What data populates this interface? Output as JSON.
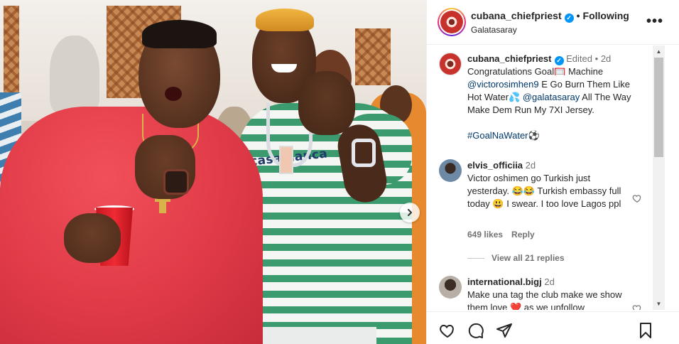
{
  "post": {
    "next_label": "›"
  },
  "header": {
    "username": "cubana_chiefpriest",
    "verified_mark": "✓",
    "separator": "•",
    "follow_label": "Following",
    "location": "Galatasaray",
    "more_label": "•••"
  },
  "photo": {
    "jersey_text": "casablanca"
  },
  "caption": {
    "username": "cubana_chiefpriest",
    "verified_mark": "✓",
    "edited": "Edited",
    "dot": "•",
    "time": "2d",
    "text_part1": "Congratulations Goal",
    "goal_emoji": "🥅",
    "text_part2": " Machine ",
    "mention1": "@victorosimhen9",
    "text_part3": " E Go Burn Them Like Hot Water",
    "water_emoji": "💦",
    "text_part4": " ",
    "mention2": "@galatasaray",
    "text_part5": " All The Way Make Dem Run My 7XI Jersey.",
    "hashtag": "#GoalNaWater",
    "ball_emoji": "⚽"
  },
  "comments": [
    {
      "username": "elvis_officiia",
      "time": "2d",
      "text": "Victor oshimen go Turkish just yesterday. 😂😂 Turkish embassy full today 😃 I swear. I too love Lagos ppl",
      "likes": "649 likes",
      "reply_label": "Reply",
      "view_replies": "View all 21 replies"
    },
    {
      "username": "international.bigj",
      "time": "2d",
      "text": "Make una tag the club make we show them love ❤️ as we unfollow"
    }
  ],
  "scrollbar": {
    "up": "▲",
    "down": "▼"
  },
  "colors": {
    "link": "#00376b",
    "verified": "#0095f6",
    "muted": "#737373"
  },
  "icons": [
    "heart-icon",
    "comment-icon",
    "share-icon",
    "save-icon",
    "more-icon",
    "chevron-right-icon"
  ]
}
